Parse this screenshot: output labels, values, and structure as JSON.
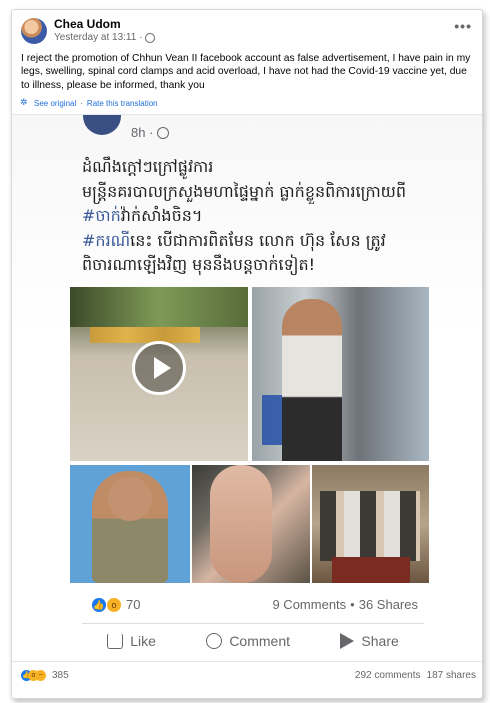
{
  "post": {
    "author": "Chea Udom",
    "time": "Yesterday at 13:11 ·",
    "text": "I reject the promotion of Chhun Vean II facebook account as false advertisement, I have pain in my legs, swelling, spinal cord clamps and acid overload, I have not had the Covid-19 vaccine yet, due to illness, please be informed, thank you",
    "translation": {
      "see_original": "See original",
      "separator": "·",
      "rate": "Rate this translation"
    },
    "reactions_count": "385",
    "comments": "292 comments",
    "shares": "187 shares"
  },
  "shared_post": {
    "time": "8h ·",
    "lines": [
      {
        "hash": "",
        "text": "ដំណឹងក្តៅៗក្រៅផ្លូវការ"
      },
      {
        "hash": "",
        "text": "មន្ត្រីនគរបាលក្រសួងមហាផ្ទៃម្នាក់ ធ្លាក់ខ្លួនពិការក្រោយពី"
      },
      {
        "hash": "#ចាក់",
        "text": "វ៉ាក់សាំងចិន។"
      },
      {
        "hash": "#ករណី",
        "text": "នេះ បើជាការពិតមែន លោក ហ៊ុន សែន ត្រូវ"
      },
      {
        "hash": "",
        "text": "ពិចារណាឡើងវិញ មុននឹងបន្តចាក់ទៀត!"
      }
    ],
    "reactions_count": "70",
    "comments": "9 Comments",
    "separator": "•",
    "shares": "36 Shares",
    "actions": {
      "like": "Like",
      "comment": "Comment",
      "share": "Share"
    }
  },
  "colors": {
    "link": "#216fdb",
    "hashtag": "#385898",
    "like_blue": "#1877f2",
    "wow_yellow": "#f7b125"
  },
  "icons": [
    "globe-icon",
    "more-icon",
    "settings-icon",
    "play-icon",
    "like-reaction-icon",
    "wow-reaction-icon",
    "sad-reaction-icon",
    "like-icon",
    "comment-icon",
    "share-icon"
  ]
}
